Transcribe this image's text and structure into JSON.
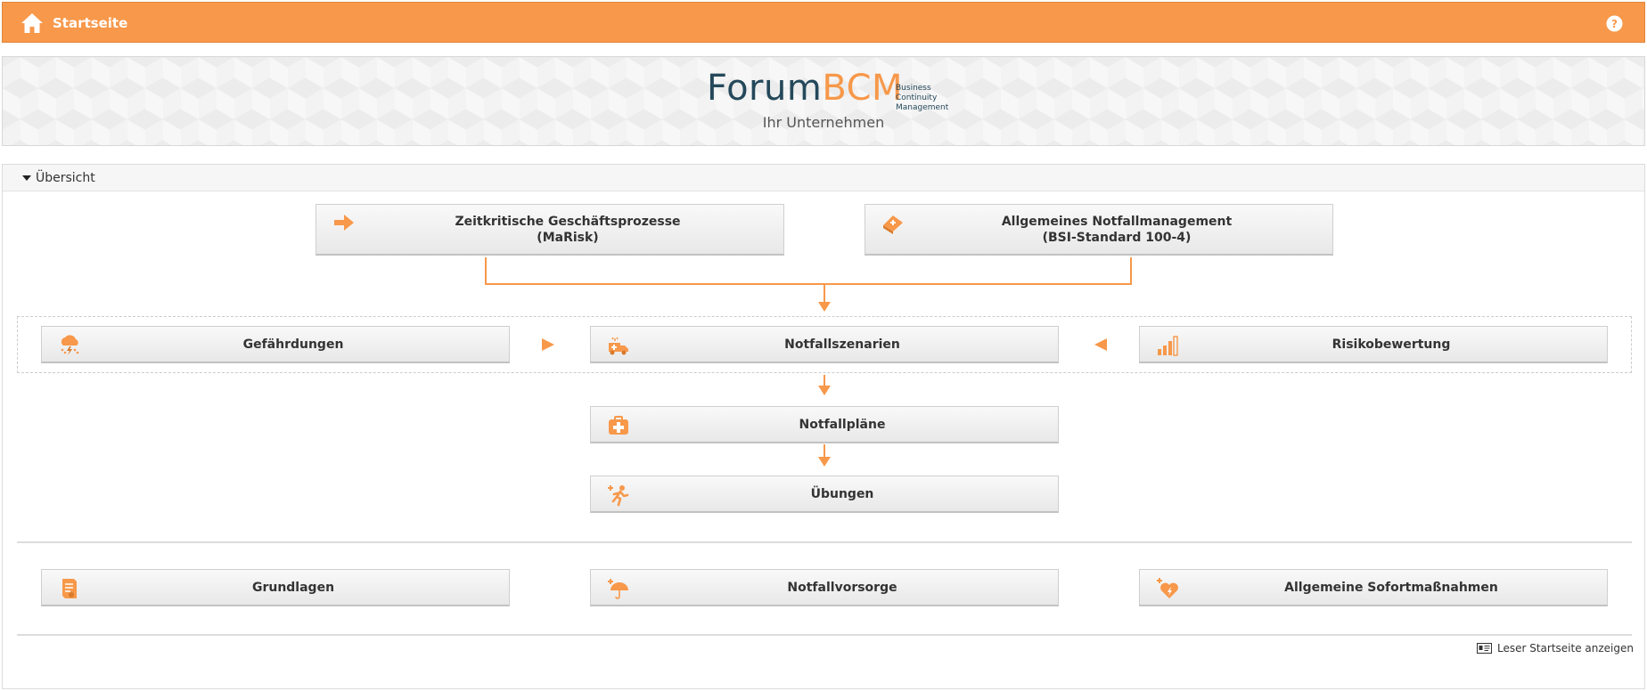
{
  "header": {
    "title": "Startseite",
    "home_icon": "home-icon",
    "help_icon": "help-icon"
  },
  "banner": {
    "logo_forum": "Forum",
    "logo_bcm": "BCM",
    "tagline": [
      "Business",
      "Continuity",
      "Management"
    ],
    "company": "Ihr Unternehmen"
  },
  "overview": {
    "title": "Übersicht",
    "tiles": {
      "zeitkritische": {
        "line1": "Zeitkritische Geschäftsprozesse",
        "line2": "(MaRisk)",
        "icon": "arrow-right-icon"
      },
      "allgemeines": {
        "line1": "Allgemeines Notfallmanagement",
        "line2": "(BSI-Standard 100-4)",
        "icon": "book-icon"
      },
      "gefaehrdungen": {
        "label": "Gefährdungen",
        "icon": "storm-cloud-icon"
      },
      "notfallszenarien": {
        "label": "Notfallszenarien",
        "icon": "ambulance-icon"
      },
      "risikobewertung": {
        "label": "Risikobewertung",
        "icon": "signal-bars-icon"
      },
      "notfallplaene": {
        "label": "Notfallpläne",
        "icon": "first-aid-kit-icon"
      },
      "uebungen": {
        "label": "Übungen",
        "icon": "running-person-icon"
      },
      "grundlagen": {
        "label": "Grundlagen",
        "icon": "document-icon"
      },
      "notfallvorsorge": {
        "label": "Notfallvorsorge",
        "icon": "umbrella-icon"
      },
      "sofortmassnahmen": {
        "label": "Allgemeine Sofortmaßnahmen",
        "icon": "heart-icon"
      }
    },
    "reader_link": {
      "label": "Leser Startseite anzeigen",
      "icon": "id-card-icon"
    }
  },
  "colors": {
    "accent": "#f7984a",
    "brand_dark": "#24485a"
  }
}
